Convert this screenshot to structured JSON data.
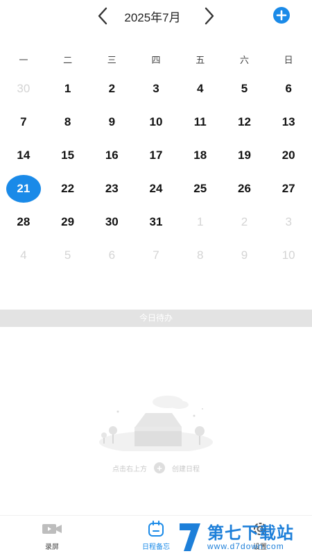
{
  "header": {
    "title": "2025年7月"
  },
  "weekdays": [
    "一",
    "二",
    "三",
    "四",
    "五",
    "六",
    "日"
  ],
  "calendar": {
    "weeks": [
      [
        {
          "d": "30",
          "m": true
        },
        {
          "d": "1"
        },
        {
          "d": "2"
        },
        {
          "d": "3"
        },
        {
          "d": "4"
        },
        {
          "d": "5"
        },
        {
          "d": "6"
        }
      ],
      [
        {
          "d": "7"
        },
        {
          "d": "8"
        },
        {
          "d": "9"
        },
        {
          "d": "10"
        },
        {
          "d": "11"
        },
        {
          "d": "12"
        },
        {
          "d": "13"
        }
      ],
      [
        {
          "d": "14"
        },
        {
          "d": "15"
        },
        {
          "d": "16"
        },
        {
          "d": "17"
        },
        {
          "d": "18"
        },
        {
          "d": "19"
        },
        {
          "d": "20"
        }
      ],
      [
        {
          "d": "21",
          "s": true
        },
        {
          "d": "22"
        },
        {
          "d": "23"
        },
        {
          "d": "24"
        },
        {
          "d": "25"
        },
        {
          "d": "26"
        },
        {
          "d": "27"
        }
      ],
      [
        {
          "d": "28"
        },
        {
          "d": "29"
        },
        {
          "d": "30"
        },
        {
          "d": "31"
        },
        {
          "d": "1",
          "m": true
        },
        {
          "d": "2",
          "m": true
        },
        {
          "d": "3",
          "m": true
        }
      ],
      [
        {
          "d": "4",
          "m": true
        },
        {
          "d": "5",
          "m": true
        },
        {
          "d": "6",
          "m": true
        },
        {
          "d": "7",
          "m": true
        },
        {
          "d": "8",
          "m": true
        },
        {
          "d": "9",
          "m": true
        },
        {
          "d": "10",
          "m": true
        }
      ]
    ]
  },
  "todo": {
    "section_title": "今日待办"
  },
  "empty": {
    "hint_left": "点击右上方",
    "hint_right": "创建日程"
  },
  "tabs": {
    "record": "录屏",
    "schedule": "日程备忘",
    "settings": "设置"
  },
  "watermark": {
    "brand": "第七下载站",
    "url": "www.d7down.com"
  },
  "colors": {
    "accent": "#1a8ae8",
    "muted": "#d4d4d4",
    "watermark": "#1d7fd9"
  }
}
